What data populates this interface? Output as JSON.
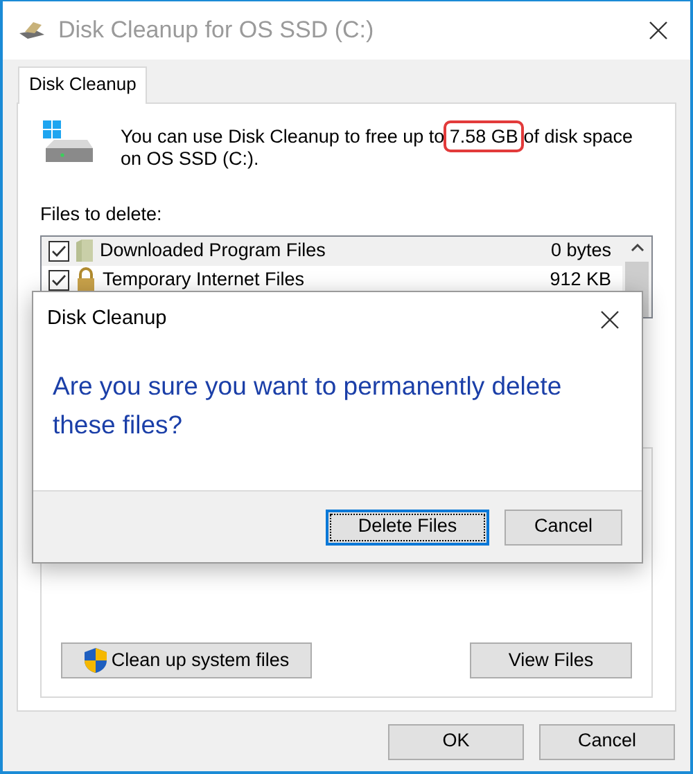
{
  "window": {
    "title": "Disk Cleanup for OS SSD (C:)"
  },
  "tabs": [
    {
      "label": "Disk Cleanup",
      "selected": true
    }
  ],
  "description": {
    "before": "You can use Disk Cleanup to free up to",
    "highlight": "7.58 GB",
    "after": "of disk space on OS SSD (C:)."
  },
  "files_label": "Files to delete:",
  "files": [
    {
      "name": "Downloaded Program Files",
      "size": "0 bytes",
      "checked": true,
      "selected": true,
      "kind": "folder"
    },
    {
      "name": "Temporary Internet Files",
      "size": "912 KB",
      "checked": true,
      "selected": false,
      "kind": "lock"
    }
  ],
  "panel_buttons": [
    {
      "label": "Clean up system files",
      "kind": "shield"
    },
    {
      "label": "View Files",
      "kind": "plain"
    }
  ],
  "buttons": [
    {
      "label": "OK"
    },
    {
      "label": "Cancel"
    }
  ],
  "dialog": {
    "title": "Disk Cleanup",
    "message": "Are you sure you want to permanently delete these files?",
    "buttons": [
      {
        "label": "Delete Files",
        "focused": true
      },
      {
        "label": "Cancel",
        "focused": false
      }
    ]
  }
}
